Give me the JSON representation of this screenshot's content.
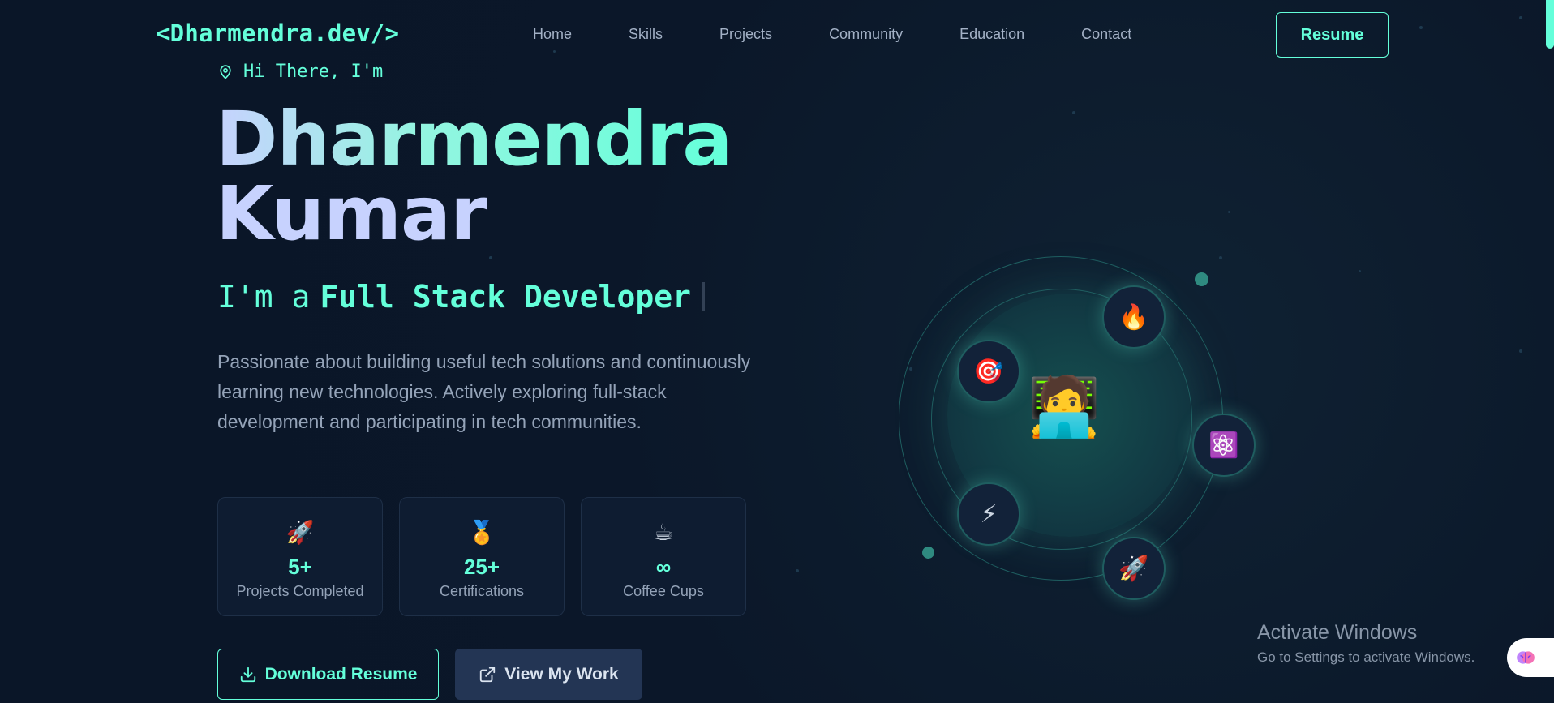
{
  "header": {
    "logo": "<Dharmendra.dev/>",
    "nav": [
      "Home",
      "Skills",
      "Projects",
      "Community",
      "Education",
      "Contact"
    ],
    "resume_label": "Resume"
  },
  "hero": {
    "greeting": "Hi There, I'm",
    "first_name": "Dharmendra",
    "last_name": "Kumar",
    "role_prefix": "I'm a",
    "role_title": "Full Stack Developer",
    "bio": "Passionate about building useful tech solutions and continuously learning new technologies. Actively exploring full-stack development and participating in tech communities."
  },
  "stats": [
    {
      "emoji": "🚀",
      "value": "5+",
      "label": "Projects Completed"
    },
    {
      "emoji": "🏅",
      "value": "25+",
      "label": "Certifications"
    },
    {
      "emoji": "☕",
      "value": "∞",
      "label": "Coffee Cups"
    }
  ],
  "actions": {
    "download_label": "Download Resume",
    "work_label": "View My Work"
  },
  "orbit": {
    "center": "🧑‍💻",
    "items": [
      "🎯",
      "🔥",
      "⚛️",
      "⚡",
      "🚀"
    ]
  },
  "watermark": {
    "title": "Activate Windows",
    "subtitle": "Go to Settings to activate Windows."
  },
  "colors": {
    "accent": "#64ffda",
    "background": "#0b1729",
    "muted": "#94a3b8"
  }
}
